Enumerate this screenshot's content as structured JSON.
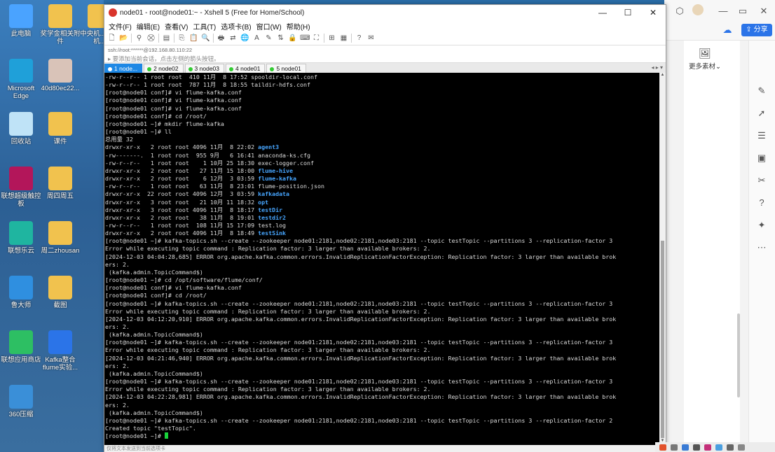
{
  "desktop": {
    "icons": [
      {
        "label": "此电脑",
        "color": "#4aa3ff"
      },
      {
        "label": "奖学金相关附件",
        "color": "#f1c24e"
      },
      {
        "label": "中央机...直属机...",
        "color": "#f1c24e"
      },
      {
        "label": "Microsoft Edge",
        "color": "#1fa0d9"
      },
      {
        "label": "40d80ec22...",
        "color": "#d9c3b8"
      },
      {
        "label": "回收站",
        "color": "#bfe3f7"
      },
      {
        "label": "课件",
        "color": "#f1c24e"
      },
      {
        "label": "联想超级触控板",
        "color": "#b3165a"
      },
      {
        "label": "周四周五",
        "color": "#f1c24e"
      },
      {
        "label": "联想乐云",
        "color": "#1fb5a0"
      },
      {
        "label": "周二zhousan",
        "color": "#f1c24e"
      },
      {
        "label": "鲁大师",
        "color": "#2f8fe0"
      },
      {
        "label": "截图",
        "color": "#f1c24e"
      },
      {
        "label": "联想应用商店",
        "color": "#2dbf63"
      },
      {
        "label": "Kafka整合flume实验...",
        "color": "#2b74e8"
      },
      {
        "label": "360压缩",
        "color": "#3a8fd8"
      }
    ]
  },
  "xshell": {
    "title": "node01 - root@node01:~ - Xshell 5 (Free for Home/School)",
    "menu": [
      "文件(F)",
      "编辑(E)",
      "查看(V)",
      "工具(T)",
      "选项卡(B)",
      "窗口(W)",
      "帮助(H)"
    ],
    "address": "ssh://root:******@192.168.80.110:22",
    "hint": "要添加当前会话，点击左侧的箭头按钮。",
    "tabs": [
      {
        "label": "1 node...",
        "dot": "#ffffff",
        "active": true
      },
      {
        "label": "2 node02",
        "dot": "#33cc33",
        "active": false
      },
      {
        "label": "3 node03",
        "dot": "#33cc33",
        "active": false
      },
      {
        "label": "4 node01",
        "dot": "#33cc33",
        "active": false
      },
      {
        "label": "5 node01",
        "dot": "#33cc33",
        "active": false
      }
    ],
    "status": "仅将文本发送到当前选项卡",
    "terminal_lines": [
      "-rw-r--r-- 1 root root  410 11月  8 17:52 spooldir-local.conf",
      "-rw-r--r-- 1 root root  787 11月  8 18:55 taildir-hdfs.conf",
      "[root@node01 conf]# vi flume-kafka.conf",
      "[root@node01 conf]# vi flume-kafka.conf",
      "[root@node01 conf]# vi flume-kafka.conf",
      "[root@node01 conf]# cd /root/",
      "[root@node01 ~]# mkdir flume-kafka",
      "[root@node01 ~]# ll",
      "总用量 32",
      "drwxr-xr-x   2 root root 4096 11月  8 22:02 |agent3",
      "-rw-------.  1 root root  955 9月   6 16:41 anaconda-ks.cfg",
      "-rw-r--r--   1 root root    1 10月 25 18:30 exec-logger.conf",
      "drwxr-xr-x   2 root root   27 11月 15 18:00 |flume-hive",
      "drwxr-xr-x   2 root root    6 12月  3 03:59 |flume-kafka",
      "-rw-r--r--   1 root root   63 11月  8 23:01 flume-position.json",
      "drwxr-xr-x  22 root root 4096 12月  3 03:59 |kafkadata",
      "drwxr-xr-x   3 root root   21 10月 11 18:32 |opt",
      "drwxr-xr-x   3 root root 4096 11月  8 18:17 |testDir",
      "drwxr-xr-x   2 root root   38 11月  8 19:01 |testdir2",
      "-rw-r--r--   1 root root  108 11月 15 17:09 test.log",
      "drwxr-xr-x   2 root root 4096 11月  8 18:49 |testSink",
      "[root@node01 ~]# kafka-topics.sh --create --zookeeper node01:2181,node02:2181,node03:2181 --topic testTopic --partitions 3 --replication-factor 3",
      "Error while executing topic command : Replication factor: 3 larger than available brokers: 2.",
      "[2024-12-03 04:04:28,685] ERROR org.apache.kafka.common.errors.InvalidReplicationFactorException: Replication factor: 3 larger than available brok",
      "ers: 2.",
      " (kafka.admin.TopicCommand$)",
      "[root@node01 ~]# cd /opt/software/flume/conf/",
      "[root@node01 conf]# vi flume-kafka.conf",
      "[root@node01 conf]# cd /root/",
      "[root@node01 ~]# kafka-topics.sh --create --zookeeper node01:2181,node02:2181,node03:2181 --topic testTopic --partitions 3 --replication-factor 3",
      "Error while executing topic command : Replication factor: 3 larger than available brokers: 2.",
      "[2024-12-03 04:12:20,910] ERROR org.apache.kafka.common.errors.InvalidReplicationFactorException: Replication factor: 3 larger than available brok",
      "ers: 2.",
      " (kafka.admin.TopicCommand$)",
      "[root@node01 ~]# kafka-topics.sh --create --zookeeper node01:2181,node02:2181,node03:2181 --topic testTopic --partitions 3 --replication-factor 3",
      "Error while executing topic command : Replication factor: 3 larger than available brokers: 2.",
      "[2024-12-03 04:21:46,940] ERROR org.apache.kafka.common.errors.InvalidReplicationFactorException: Replication factor: 3 larger than available brok",
      "ers: 2.",
      " (kafka.admin.TopicCommand$)",
      "[root@node01 ~]# kafka-topics.sh --create --zookeeper node01:2181,node02:2181,node03:2181 --topic testTopic --partitions 3 --replication-factor 3",
      "Error while executing topic command : Replication factor: 3 larger than available brokers: 2.",
      "[2024-12-03 04:22:28,981] ERROR org.apache.kafka.common.errors.InvalidReplicationFactorException: Replication factor: 3 larger than available brok",
      "ers: 2.",
      " (kafka.admin.TopicCommand$)",
      "[root@node01 ~]# kafka-topics.sh --create --zookeeper node01:2181,node02:2181,node03:2181 --topic testTopic --partitions 3 --replication-factor 2",
      "Created topic \"testTopic\".",
      "[root@node01 ~]# "
    ]
  },
  "right_app": {
    "share_label": "分享",
    "more_material": "更多素材"
  },
  "colors": {
    "dir": "#47a6ff",
    "cursor": "#19d33b",
    "tab_active": "#1e88e5"
  }
}
